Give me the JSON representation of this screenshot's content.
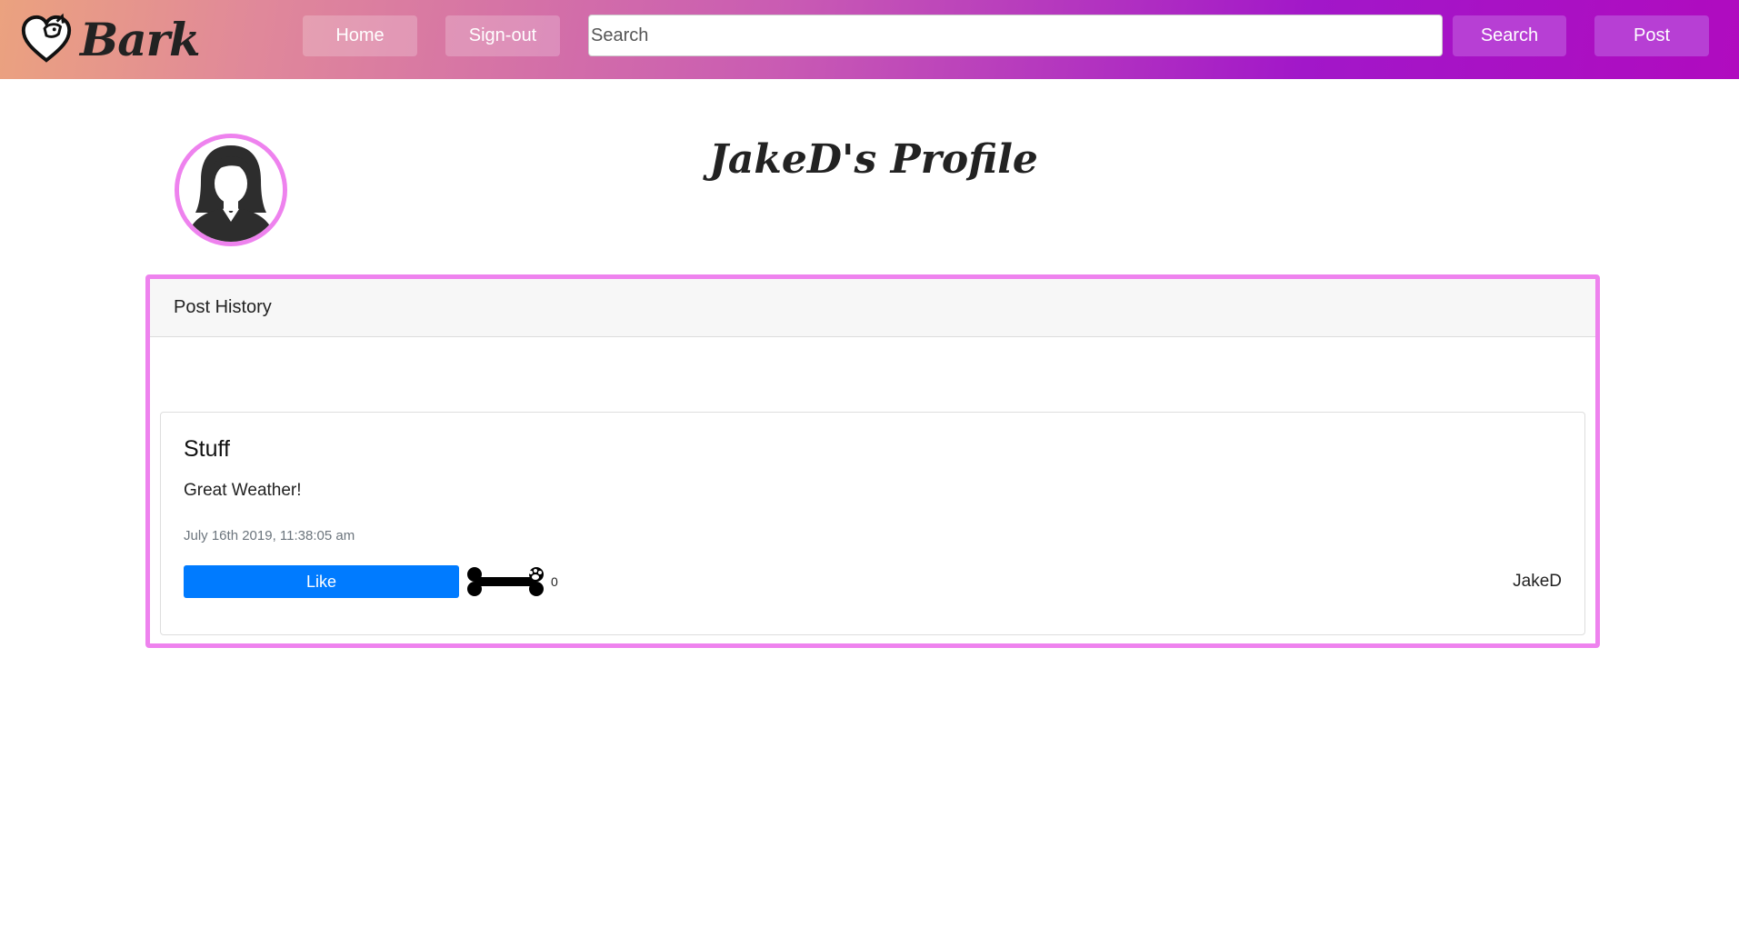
{
  "navbar": {
    "brand": "Bark",
    "home_label": "Home",
    "signout_label": "Sign-out",
    "search_placeholder": "Search",
    "search_label": "Search",
    "post_label": "Post",
    "gradient_colors": [
      "#eba27f",
      "#a217c9"
    ],
    "accent_button_color": "#b73fd4"
  },
  "profile": {
    "title": "JakeD's Profile",
    "avatar_icon": "female-user-avatar-icon",
    "accent_border": "#ee82ee"
  },
  "history": {
    "header": "Post History",
    "posts": [
      {
        "title": "Stuff",
        "body": "Great Weather!",
        "timestamp": "July 16th 2019, 11:38:05 am",
        "like_label": "Like",
        "like_icon": "bone-paw-icon",
        "like_count": "0",
        "author": "JakeD"
      }
    ]
  },
  "colors": {
    "like_button": "#007bff"
  }
}
